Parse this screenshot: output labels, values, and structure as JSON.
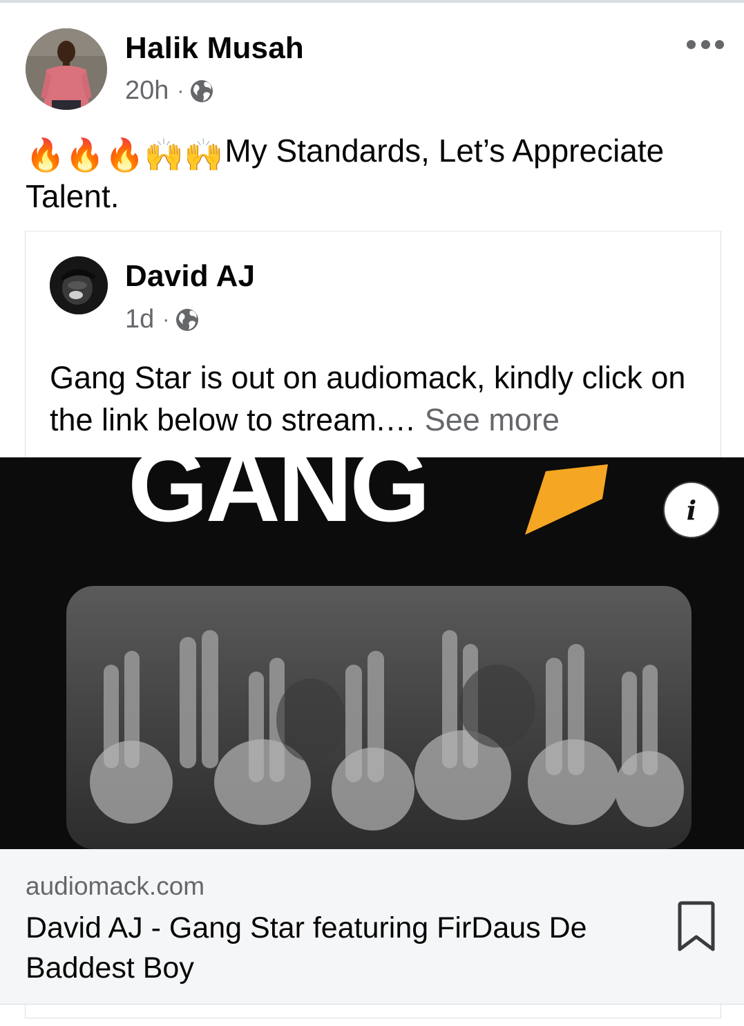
{
  "post": {
    "author": "Halik Musah",
    "time": "20h",
    "separator": "·",
    "privacy_icon": "globe-icon",
    "text_emojis": "🔥🔥🔥🙌🙌",
    "text": "My Standards, Let’s Appreciate Talent.",
    "more_icon": "more-options-icon"
  },
  "shared_post": {
    "author": "David AJ",
    "time": "1d",
    "separator": "·",
    "privacy_icon": "globe-icon",
    "text": "Gang Star is out on audiomack, kindly click on the link below to stream.…",
    "see_more": "See more"
  },
  "link_preview": {
    "image_text": "GANG",
    "info_icon": "i",
    "domain": "audiomack.com",
    "title": "David AJ - Gang Star featuring FirDaus De Baddest Boy",
    "bookmark_icon": "bookmark-icon"
  },
  "colors": {
    "text": "#050505",
    "secondary": "#65676b",
    "caption_bg": "#f5f6f7",
    "star": "#f5a623"
  }
}
